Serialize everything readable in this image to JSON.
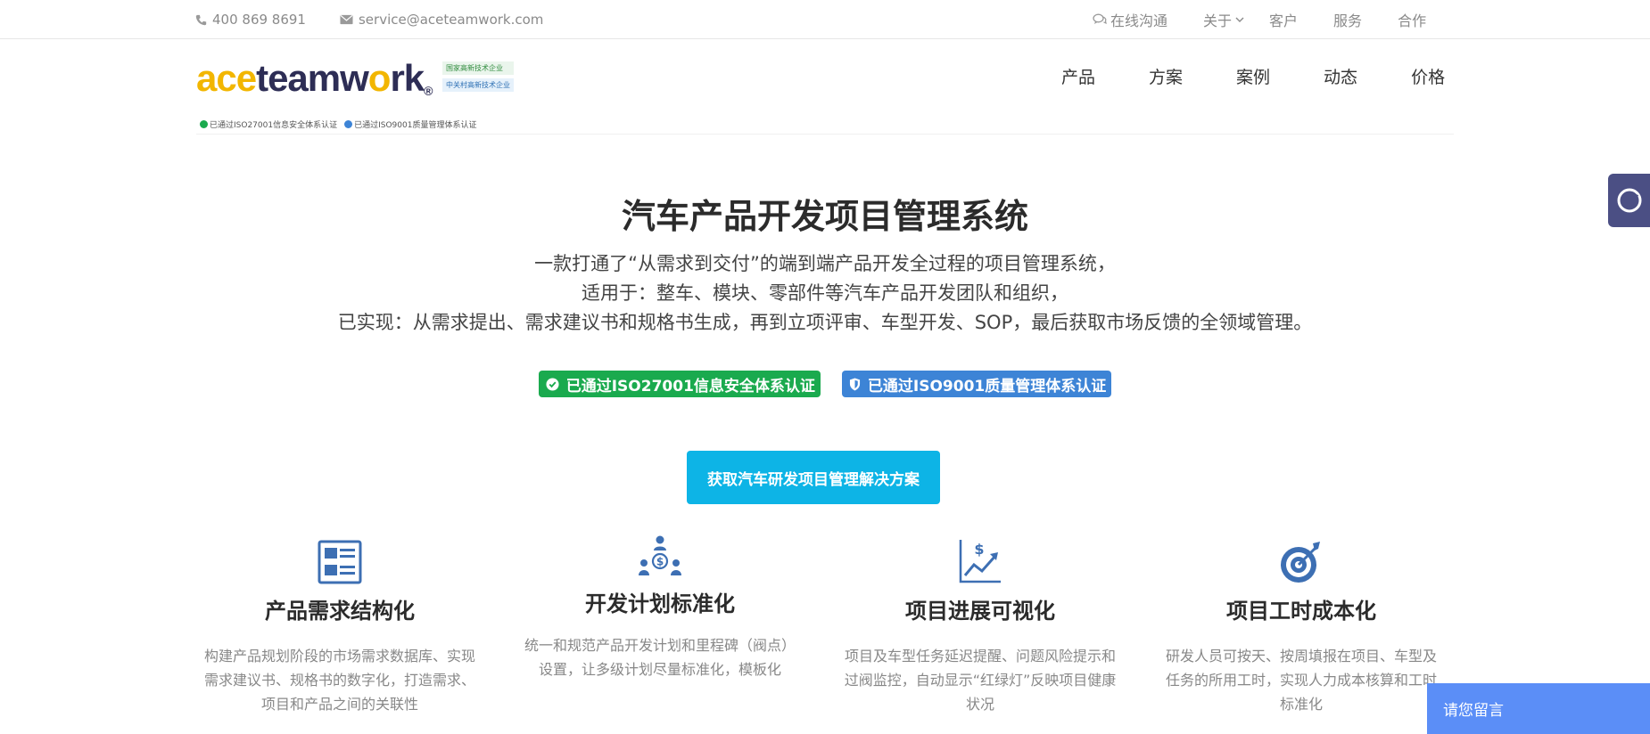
{
  "topbar": {
    "phone": "400 869 8691",
    "email": "service@aceteamwork.com",
    "links": [
      "在线沟通",
      "关于",
      "客户",
      "服务",
      "合作"
    ]
  },
  "logo": {
    "ace": "ace",
    "teamwork": "teamw",
    "o": "o",
    "rk": "rk",
    "reg": "®",
    "tag1": "国家高新技术企业",
    "tag2": "中关村高新技术企业",
    "cert1": "已通过ISO27001信息安全体系认证",
    "cert2": "已通过ISO9001质量管理体系认证"
  },
  "nav": [
    "产品",
    "方案",
    "案例",
    "动态",
    "价格"
  ],
  "hero": {
    "title": "汽车产品开发项目管理系统",
    "line1": "一款打通了“从需求到交付”的端到端产品开发全过程的项目管理系统，",
    "line2": "适用于：整车、模块、零部件等汽车产品开发团队和组织，",
    "line3": "已实现：从需求提出、需求建议书和规格书生成，再到立项评审、车型开发、SOP，最后获取市场反馈的全领域管理。",
    "badge1": "已通过ISO27001信息安全体系认证",
    "badge2": "已通过ISO9001质量管理体系认证",
    "cta": "获取汽车研发项目管理解决方案"
  },
  "features": [
    {
      "title": "产品需求结构化",
      "desc": "构建产品规划阶段的市场需求数据库、实现需求建议书、规格书的数字化，打造需求、项目和产品之间的关联性"
    },
    {
      "title": "开发计划标准化",
      "desc": "统一和规范产品开发计划和里程碑（阀点）设置，让多级计划尽量标准化，模板化"
    },
    {
      "title": "项目进展可视化",
      "desc": "项目及车型任务延迟提醒、问题风险提示和过阀监控，自动显示“红绿灯”反映项目健康状况"
    },
    {
      "title": "项目工时成本化",
      "desc": "研发人员可按天、按周填报在项目、车型及任务的所用工时，实现人力成本核算和工时标准化"
    }
  ],
  "message_bar": "请您留言",
  "colors": {
    "cta": "#0db4e6",
    "green": "#1aaa4e",
    "blue": "#3d84d6",
    "icon": "#3d6fb3",
    "brand_yellow": "#f2b600",
    "brand_navy": "#2d2d55"
  }
}
